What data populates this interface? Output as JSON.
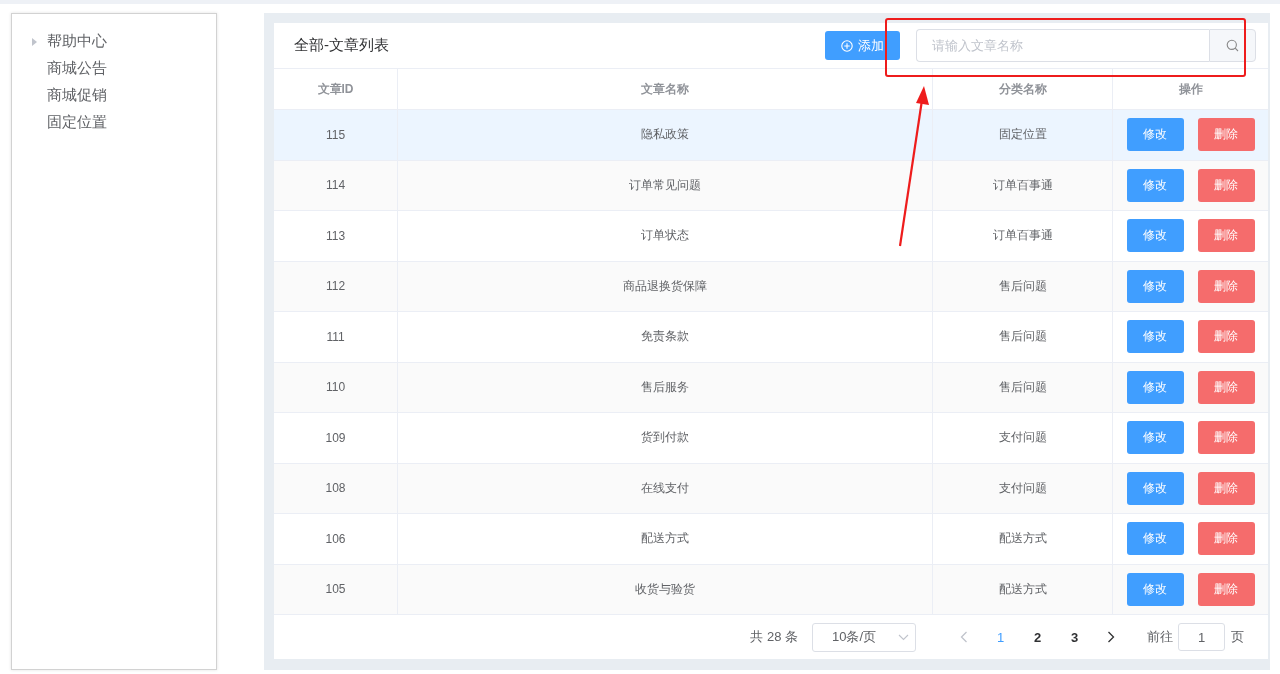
{
  "sidebar": {
    "items": [
      {
        "label": "帮助中心",
        "expandable": true
      },
      {
        "label": "商城公告",
        "expandable": false
      },
      {
        "label": "商城促销",
        "expandable": false
      },
      {
        "label": "固定位置",
        "expandable": false
      }
    ]
  },
  "header": {
    "title": "全部-文章列表",
    "add_button": "添加",
    "search": {
      "placeholder": "请输入文章名称"
    }
  },
  "table": {
    "columns": [
      "文章ID",
      "文章名称",
      "分类名称",
      "操作"
    ],
    "rows": [
      {
        "id": "115",
        "name": "隐私政策",
        "category": "固定位置",
        "highlighted": true,
        "edit": "修改",
        "delete": "删除"
      },
      {
        "id": "114",
        "name": "订单常见问题",
        "category": "订单百事通",
        "highlighted": false,
        "edit": "修改",
        "delete": "删除"
      },
      {
        "id": "113",
        "name": "订单状态",
        "category": "订单百事通",
        "highlighted": false,
        "edit": "修改",
        "delete": "删除"
      },
      {
        "id": "112",
        "name": "商品退换货保障",
        "category": "售后问题",
        "highlighted": false,
        "edit": "修改",
        "delete": "删除"
      },
      {
        "id": "111",
        "name": "免责条款",
        "category": "售后问题",
        "highlighted": false,
        "edit": "修改",
        "delete": "删除"
      },
      {
        "id": "110",
        "name": "售后服务",
        "category": "售后问题",
        "highlighted": false,
        "edit": "修改",
        "delete": "删除"
      },
      {
        "id": "109",
        "name": "货到付款",
        "category": "支付问题",
        "highlighted": false,
        "edit": "修改",
        "delete": "删除"
      },
      {
        "id": "108",
        "name": "在线支付",
        "category": "支付问题",
        "highlighted": false,
        "edit": "修改",
        "delete": "删除"
      },
      {
        "id": "106",
        "name": "配送方式",
        "category": "配送方式",
        "highlighted": false,
        "edit": "修改",
        "delete": "删除"
      },
      {
        "id": "105",
        "name": "收货与验货",
        "category": "配送方式",
        "highlighted": false,
        "edit": "修改",
        "delete": "删除"
      }
    ]
  },
  "pagination": {
    "total": "共 28 条",
    "page_size": "10条/页",
    "pages": [
      {
        "label": "1",
        "selected": true
      },
      {
        "label": "2",
        "selected": false
      },
      {
        "label": "3",
        "selected": false
      }
    ],
    "goto_label": "前往",
    "goto_value": "1",
    "page_suffix": "页"
  },
  "annotations": {
    "highlight_box": true,
    "arrow": true
  }
}
